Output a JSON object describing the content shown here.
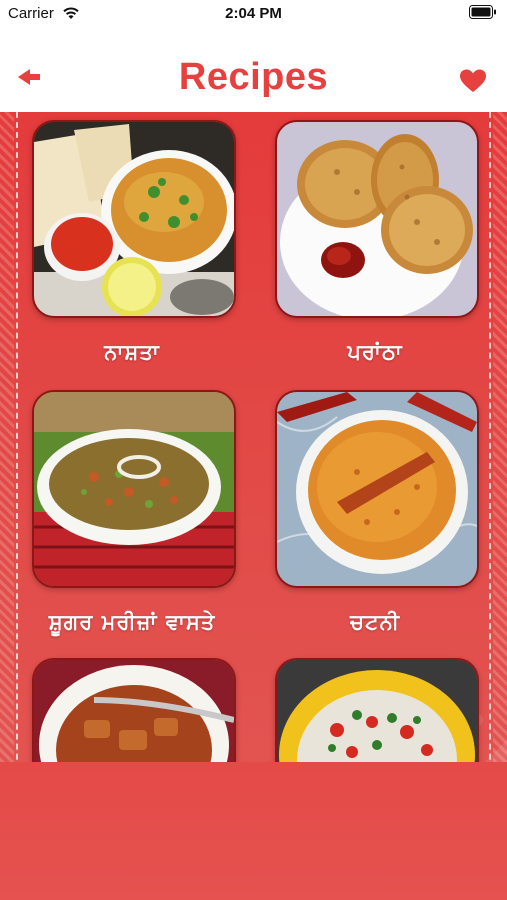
{
  "status_bar": {
    "carrier": "Carrier",
    "time": "2:04 PM"
  },
  "nav": {
    "title": "Recipes",
    "back_icon": "back-arrow-icon",
    "favorite_icon": "heart-icon"
  },
  "colors": {
    "accent": "#e6403f",
    "background": "#e43b3b",
    "card_border": "#8d1616"
  },
  "categories": [
    {
      "label": "ਨਾਸ਼ਤਾ",
      "image": "breakfast-photo"
    },
    {
      "label": "ਪਰਾਂਠਾ",
      "image": "paratha-photo"
    },
    {
      "label": "ਸ਼ੂਗਰ ਮਰੀਜ਼ਾਂ ਵਾਸਤੇ",
      "image": "diabetic-dish-photo"
    },
    {
      "label": "ਚਟਨੀ",
      "image": "chutney-photo"
    },
    {
      "label": "",
      "image": "curry-photo"
    },
    {
      "label": "",
      "image": "salad-photo"
    }
  ]
}
